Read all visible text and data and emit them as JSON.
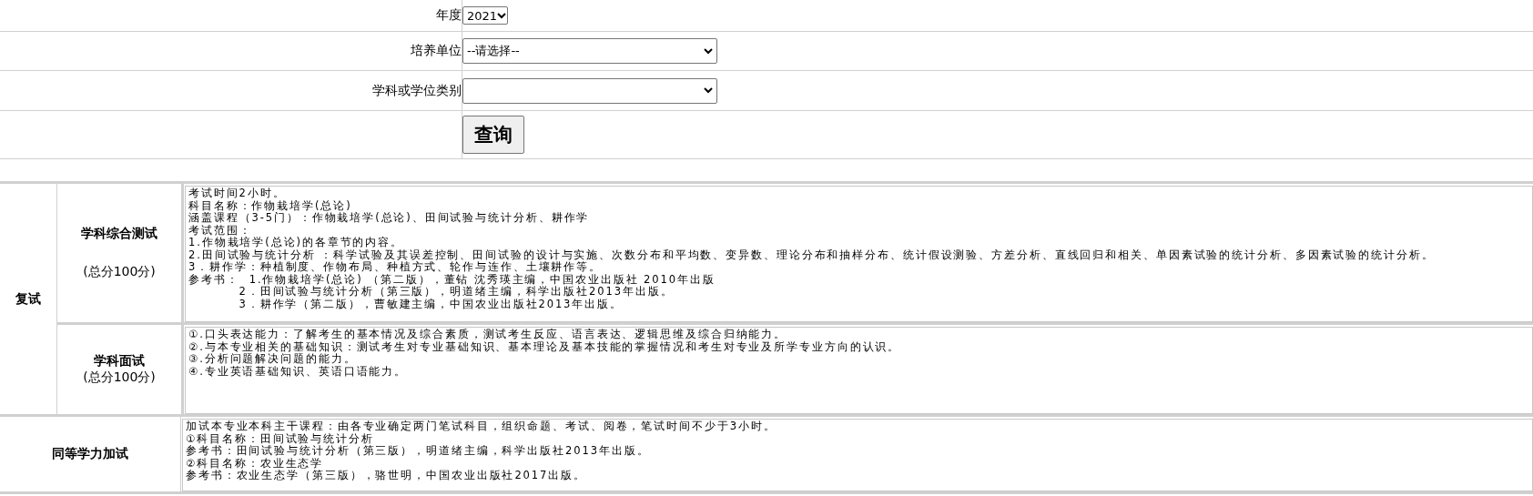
{
  "form": {
    "fields": [
      {
        "label": "年度",
        "kind": "small-select",
        "value": "2021"
      },
      {
        "label": "培养单位",
        "kind": "select",
        "value": "--请选择--"
      },
      {
        "label": "学科或学位类别",
        "kind": "select"
      }
    ],
    "submit": "查询"
  },
  "sections": [
    {
      "title": "复试",
      "items": [
        {
          "name": "学科综合测试",
          "score": "(总分100分)",
          "lines": [
            "考试时间2小时。",
            "科目名称：作物栽培学(总论)",
            "涵盖课程（3-5门）：作物栽培学(总论)、田间试验与统计分析、耕作学",
            "考试范围：",
            "1.作物栽培学(总论)的各章节的内容。",
            "2.田间试验与统计分析 ：科学试验及其误差控制、田间试验的设计与实施、次数分布和平均数、变异数、理论分布和抽样分布、统计假设测验、方差分析、直线回归和相关、单因素试验的统计分析、多因素试验的统计分析。",
            "3．耕作学：种植制度、作物布局、种植方式、轮作与连作、土壤耕作等。",
            "参考书：  1.作物栽培学(总论) （第二版），董钻 沈秀瑛主编，中国农业出版社 2010年出版",
            "          2．田间试验与统计分析（第三版），明道绪主编，科学出版社2013年出版。",
            "          3．耕作学（第二版），曹敏建主编，中国农业出版社2013年出版。"
          ]
        },
        {
          "name": "学科面试",
          "score": "(总分100分)",
          "lines": [
            "①.口头表达能力：了解考生的基本情况及综合素质，测试考生反应、语言表达、逻辑思维及综合归纳能力。",
            "②.与本专业相关的基础知识：测试考生对专业基础知识、基本理论及基本技能的掌握情况和考生对专业及所学专业方向的认识。",
            "③.分析问题解决问题的能力。",
            "④.专业英语基础知识、英语口语能力。"
          ]
        }
      ]
    },
    {
      "title": "同等学力加试",
      "items": [
        {
          "lines": [
            "加试本专业本科主干课程：由各专业确定两门笔试科目，组织命题、考试、阅卷，笔试时间不少于3小时。",
            "①科目名称：田间试验与统计分析",
            "参考书：田间试验与统计分析（第三版），明道绪主编，科学出版社2013年出版。",
            "②科目名称：农业生态学",
            "参考书：农业生态学（第三版），骆世明，中国农业出版社2017出版。"
          ]
        }
      ]
    }
  ]
}
